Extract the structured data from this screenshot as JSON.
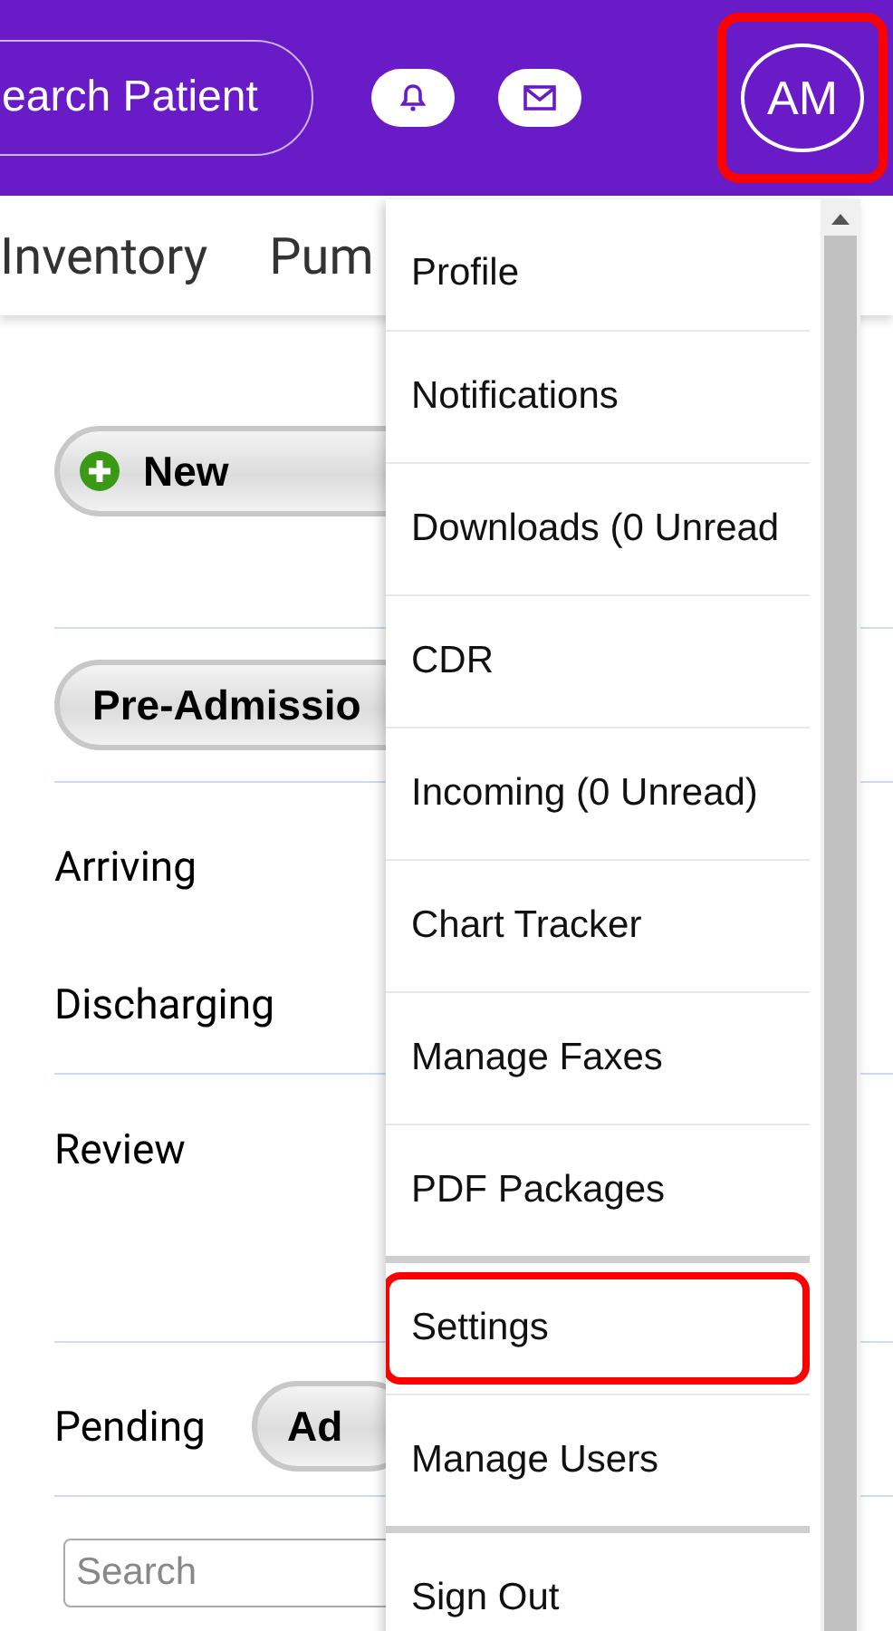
{
  "header": {
    "search_button": "earch Patient",
    "avatar": {
      "initials": "AM",
      "highlighted": true
    }
  },
  "nav": [
    "Inventory",
    "Pum"
  ],
  "main": {
    "new_button": "New",
    "filter_button": "Pre-Admissio",
    "rows": [
      {
        "label": "Arriving",
        "kind": "short",
        "divider_above": true
      },
      {
        "label": "Discharging",
        "kind": "short",
        "divider_above": false
      },
      {
        "label": "Review",
        "kind": "tall",
        "divider_above": true
      },
      {
        "label": "Pending",
        "button": "Ad",
        "kind": "short",
        "divider_above": true
      }
    ],
    "search": {
      "placeholder": "Search"
    }
  },
  "menu": {
    "items": [
      {
        "label": "Profile",
        "highlighted": false,
        "group_start": false
      },
      {
        "label": "Notifications",
        "highlighted": false,
        "group_start": false
      },
      {
        "label": "Downloads (0 Unread",
        "highlighted": false,
        "group_start": false
      },
      {
        "label": "CDR",
        "highlighted": false,
        "group_start": false
      },
      {
        "label": "Incoming (0 Unread)",
        "highlighted": false,
        "group_start": false
      },
      {
        "label": "Chart Tracker",
        "highlighted": false,
        "group_start": false
      },
      {
        "label": "Manage Faxes",
        "highlighted": false,
        "group_start": false
      },
      {
        "label": "PDF Packages",
        "highlighted": false,
        "group_start": false
      },
      {
        "label": "Settings",
        "highlighted": true,
        "group_start": true
      },
      {
        "label": "Manage Users",
        "highlighted": false,
        "group_start": false
      },
      {
        "label": "Sign Out",
        "highlighted": false,
        "group_start": true
      }
    ]
  }
}
